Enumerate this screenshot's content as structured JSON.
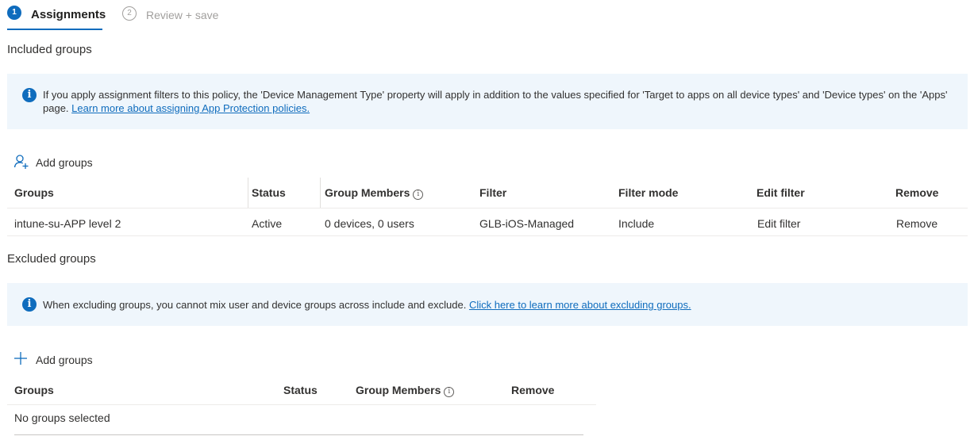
{
  "stepper": {
    "steps": [
      {
        "number": "1",
        "label": "Assignments"
      },
      {
        "number": "2",
        "label": "Review + save"
      }
    ]
  },
  "included": {
    "title": "Included groups",
    "info_text": "If you apply assignment filters to this policy, the 'Device Management Type' property will apply in addition to the values specified for 'Target to apps on all device types' and 'Device types' on the 'Apps' page.",
    "info_link": "Learn more about assigning App Protection policies.",
    "add_groups_label": "Add groups",
    "columns": [
      "Groups",
      "Status",
      "Group Members",
      "Filter",
      "Filter mode",
      "Edit filter",
      "Remove"
    ],
    "rows": [
      {
        "group": "intune-su-APP level 2",
        "status": "Active",
        "members": "0 devices, 0 users",
        "filter": "GLB-iOS-Managed",
        "filter_mode": "Include",
        "edit_filter": "Edit filter",
        "remove": "Remove"
      }
    ]
  },
  "excluded": {
    "title": "Excluded groups",
    "info_text": "When excluding groups, you cannot mix user and device groups across include and exclude.",
    "info_link": "Click here to learn more about excluding groups.",
    "add_groups_label": "Add groups",
    "columns": [
      "Groups",
      "Status",
      "Group Members",
      "Remove"
    ],
    "empty_text": "No groups selected"
  },
  "icons": {
    "info": "info-icon",
    "tooltip": "info-circle-icon",
    "add_user": "add-user-icon",
    "add": "plus-icon"
  },
  "colors": {
    "accent": "#0f6cbd",
    "info_background": "#eff6fc"
  }
}
